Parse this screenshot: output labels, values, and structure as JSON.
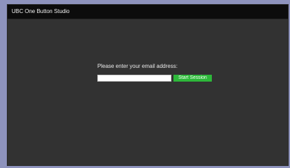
{
  "window": {
    "title": "UBC One Button Studio"
  },
  "login": {
    "prompt": "Please enter your email address:",
    "email_value": "",
    "start_label": "Start Session"
  },
  "colors": {
    "desktop_background": "#8e93bd",
    "window_background": "#323232",
    "titlebar_background": "#0c0c0c",
    "start_button": "#2db83a"
  }
}
